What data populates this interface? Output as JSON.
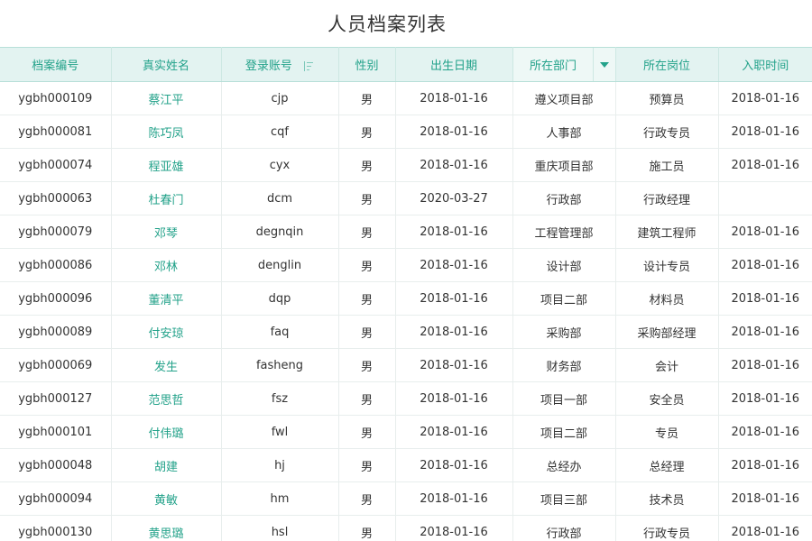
{
  "page": {
    "title": "人员档案列表"
  },
  "colors": {
    "accent": "#23a28a",
    "header_bg": "#e3f3f1",
    "text": "#333333",
    "border": "#e8eeed"
  },
  "columns": [
    {
      "key": "archive_no",
      "label": "档案编号"
    },
    {
      "key": "real_name",
      "label": "真实姓名"
    },
    {
      "key": "login",
      "label": "登录账号",
      "icon": "sort-icon"
    },
    {
      "key": "gender",
      "label": "性别"
    },
    {
      "key": "birth",
      "label": "出生日期"
    },
    {
      "key": "dept",
      "label": "所在部门",
      "icon": "filter-dropdown-icon"
    },
    {
      "key": "post",
      "label": "所在岗位"
    },
    {
      "key": "hire",
      "label": "入职时间"
    }
  ],
  "rows": [
    [
      "ygbh000109",
      "蔡江平",
      "cjp",
      "男",
      "2018-01-16",
      "遵义项目部",
      "预算员",
      "2018-01-16"
    ],
    [
      "ygbh000081",
      "陈巧凤",
      "cqf",
      "男",
      "2018-01-16",
      "人事部",
      "行政专员",
      "2018-01-16"
    ],
    [
      "ygbh000074",
      "程亚雄",
      "cyx",
      "男",
      "2018-01-16",
      "重庆项目部",
      "施工员",
      "2018-01-16"
    ],
    [
      "ygbh000063",
      "杜春门",
      "dcm",
      "男",
      "2020-03-27",
      "行政部",
      "行政经理",
      ""
    ],
    [
      "ygbh000079",
      "邓琴",
      "degnqin",
      "男",
      "2018-01-16",
      "工程管理部",
      "建筑工程师",
      "2018-01-16"
    ],
    [
      "ygbh000086",
      "邓林",
      "denglin",
      "男",
      "2018-01-16",
      "设计部",
      "设计专员",
      "2018-01-16"
    ],
    [
      "ygbh000096",
      "董清平",
      "dqp",
      "男",
      "2018-01-16",
      "项目二部",
      "材料员",
      "2018-01-16"
    ],
    [
      "ygbh000089",
      "付安琼",
      "faq",
      "男",
      "2018-01-16",
      "采购部",
      "采购部经理",
      "2018-01-16"
    ],
    [
      "ygbh000069",
      "发生",
      "fasheng",
      "男",
      "2018-01-16",
      "财务部",
      "会计",
      "2018-01-16"
    ],
    [
      "ygbh000127",
      "范思哲",
      "fsz",
      "男",
      "2018-01-16",
      "项目一部",
      "安全员",
      "2018-01-16"
    ],
    [
      "ygbh000101",
      "付伟璐",
      "fwl",
      "男",
      "2018-01-16",
      "项目二部",
      "专员",
      "2018-01-16"
    ],
    [
      "ygbh000048",
      "胡建",
      "hj",
      "男",
      "2018-01-16",
      "总经办",
      "总经理",
      "2018-01-16"
    ],
    [
      "ygbh000094",
      "黄敏",
      "hm",
      "男",
      "2018-01-16",
      "项目三部",
      "技术员",
      "2018-01-16"
    ],
    [
      "ygbh000130",
      "黄思璐",
      "hsl",
      "男",
      "2018-01-16",
      "行政部",
      "行政专员",
      "2018-01-16"
    ]
  ]
}
